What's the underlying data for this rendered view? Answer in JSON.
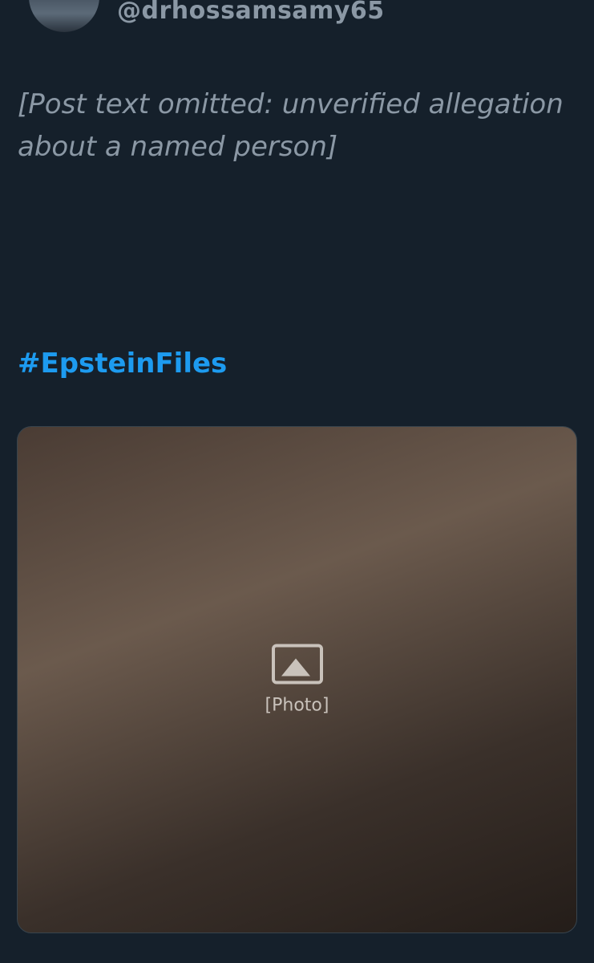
{
  "author": {
    "handle": "@drhossamsamy65"
  },
  "post": {
    "text_placeholder": "[Post text omitted: unverified allegation about a named person]",
    "hashtag": "#EpsteinFiles"
  },
  "media": {
    "placeholder_label": "[Photo]",
    "icon": "photo-icon"
  },
  "colors": {
    "background": "#15202b",
    "text": "#f2f4f5",
    "link": "#1d9bf0",
    "muted": "#8b98a5"
  }
}
